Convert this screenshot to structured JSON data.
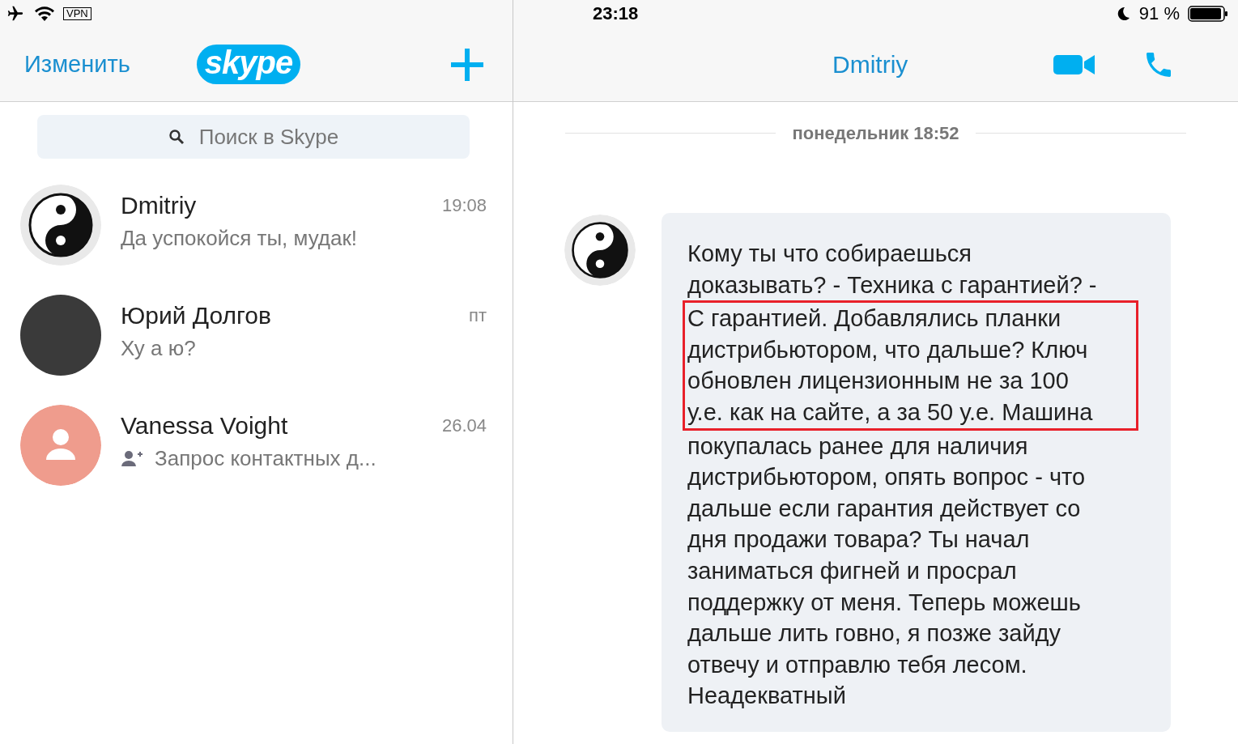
{
  "status_bar": {
    "vpn": "VPN",
    "time": "23:18",
    "battery": "91 %"
  },
  "left_header": {
    "edit": "Изменить",
    "logo": "skype"
  },
  "search": {
    "placeholder": "Поиск в Skype"
  },
  "chats": [
    {
      "name": "Dmitriy",
      "time": "19:08",
      "preview": "Да успокойся ты, мудак!",
      "kind": "yinyang",
      "request": false
    },
    {
      "name": "Юрий Долгов",
      "time": "пт",
      "preview": "Ху а ю?",
      "kind": "photo",
      "request": false
    },
    {
      "name": "Vanessa Voight",
      "time": "26.04",
      "preview": "Запрос контактных д...",
      "kind": "default",
      "request": true
    }
  ],
  "chat": {
    "title": "Dmitriy",
    "date": "понедельник 18:52",
    "message": [
      {
        "highlighted": false,
        "lines": [
          "Кому ты что собираешься",
          "доказывать? - Техника с гарантией? -"
        ]
      },
      {
        "highlighted": true,
        "lines": [
          "С гарантией. Добавлялись планки",
          "дистрибьютором, что дальше? Ключ",
          "обновлен лицензионным не за 100",
          "у.е. как на сайте, а за 50 у.е. Машина"
        ]
      },
      {
        "highlighted": false,
        "lines": [
          "покупалась ранее для наличия",
          "дистрибьютором, опять вопрос - что",
          "дальше если гарантия действует со",
          "дня продажи товара? Ты начал",
          "заниматься фигней и просрал",
          "поддержку от меня. Теперь можешь",
          "дальше лить говно, я позже зайду",
          "отвечу и отправлю тебя лесом.",
          "Неадекватный"
        ]
      }
    ]
  }
}
